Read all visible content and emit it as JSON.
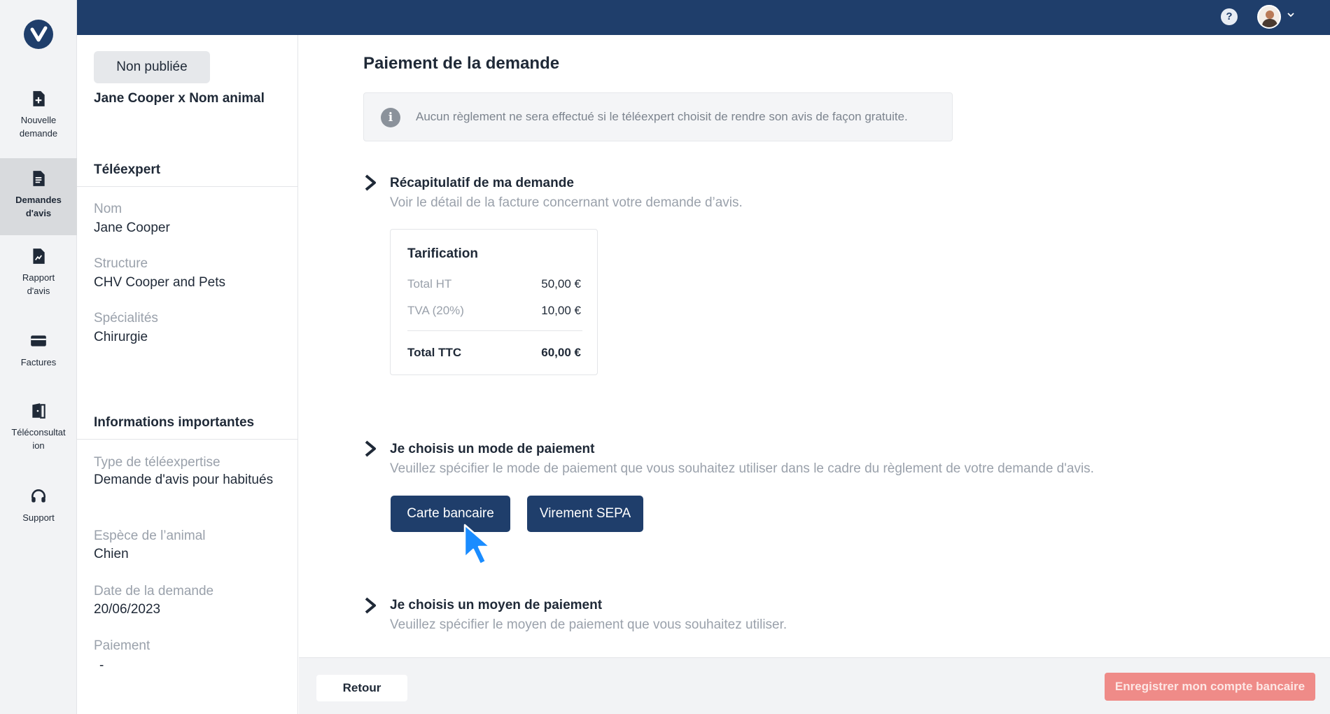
{
  "sidebar": {
    "items": [
      {
        "label_line1": "Nouvelle",
        "label_line2": "demande",
        "icon": "file-plus-icon"
      },
      {
        "label_line1": "Demandes",
        "label_line2": "d'avis",
        "icon": "document-icon"
      },
      {
        "label_line1": "Rapport",
        "label_line2": "d'avis",
        "icon": "report-icon"
      },
      {
        "label_line1": "Factures",
        "label_line2": "",
        "icon": "credit-card-icon"
      },
      {
        "label_line1": "Téléconsultat",
        "label_line2": "ion",
        "icon": "door-icon"
      },
      {
        "label_line1": "Support",
        "label_line2": "",
        "icon": "headset-icon"
      }
    ],
    "active_index": 1
  },
  "topbar": {
    "help": "?"
  },
  "detail": {
    "status": "Non publiée",
    "title": "Jane Cooper x Nom animal",
    "teleexpert_heading": "Téléexpert",
    "nom_label": "Nom",
    "nom_value": "Jane Cooper",
    "structure_label": "Structure",
    "structure_value": "CHV Cooper and Pets",
    "specialites_label": "Spécialités",
    "specialites_value": "Chirurgie",
    "infos_heading": "Informations importantes",
    "type_label": "Type de téléexpertise",
    "type_value": "Demande d'avis pour habitués",
    "espece_label": "Espèce de l’animal",
    "espece_value": "Chien",
    "date_label": "Date de la demande",
    "date_value": "20/06/2023",
    "paiement_label": "Paiement",
    "paiement_value": "-"
  },
  "main": {
    "title": "Paiement de la demande",
    "info_text": "Aucun règlement ne sera effectué si le téléexpert choisit de rendre son avis de façon gratuite.",
    "recap_title": "Récapitulatif de ma demande",
    "recap_sub": "Voir le détail de la facture concernant votre demande d’avis.",
    "tarification": {
      "title": "Tarification",
      "ht_label": "Total HT",
      "ht_value": "50,00 €",
      "tva_label": "TVA (20%)",
      "tva_value": "10,00 €",
      "ttc_label": "Total TTC",
      "ttc_value": "60,00 €"
    },
    "mode_title": "Je choisis un mode de paiement",
    "mode_sub": "Veuillez spécifier le mode de paiement que vous souhaitez utiliser dans le cadre du règlement de votre demande d'avis.",
    "btn_carte": "Carte bancaire",
    "btn_sepa": "Virement SEPA",
    "moyen_title": "Je choisis un moyen de paiement",
    "moyen_sub": "Veuillez spécifier le moyen de paiement que vous souhaitez utiliser."
  },
  "footer": {
    "back": "Retour",
    "save": "Enregistrer mon compte bancaire"
  },
  "colors": {
    "brand": "#1f3e6b",
    "disabled_cta": "#ef8b88",
    "cursor": "#1a8cff"
  }
}
